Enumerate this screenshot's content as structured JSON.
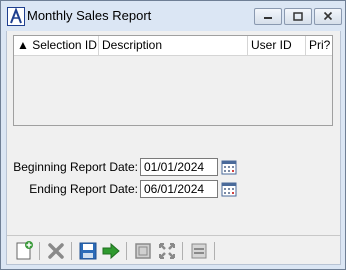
{
  "window": {
    "title": "Monthly Sales Report"
  },
  "grid": {
    "columns": [
      {
        "label": "▲ Selection ID"
      },
      {
        "label": "Description"
      },
      {
        "label": "User ID"
      },
      {
        "label": "Pri?"
      }
    ],
    "rows": []
  },
  "form": {
    "beginning": {
      "label": "Beginning Report Date:",
      "value": "01/01/2024"
    },
    "ending": {
      "label": "Ending Report Date:",
      "value": "06/01/2024"
    }
  },
  "toolbar": {
    "buttons": [
      {
        "icon": "new-document-icon",
        "enabled": true
      },
      {
        "icon": "delete-icon",
        "enabled": false
      },
      {
        "icon": "save-icon",
        "enabled": true
      },
      {
        "icon": "run-arrow-icon",
        "enabled": true
      },
      {
        "icon": "page-icon",
        "enabled": false
      },
      {
        "icon": "expand-icon",
        "enabled": false
      },
      {
        "icon": "list-icon",
        "enabled": false
      }
    ]
  },
  "colors": {
    "accent": "#1f3f8f",
    "frame": "#dbe6f4",
    "close_hover": "#c43b3b"
  }
}
